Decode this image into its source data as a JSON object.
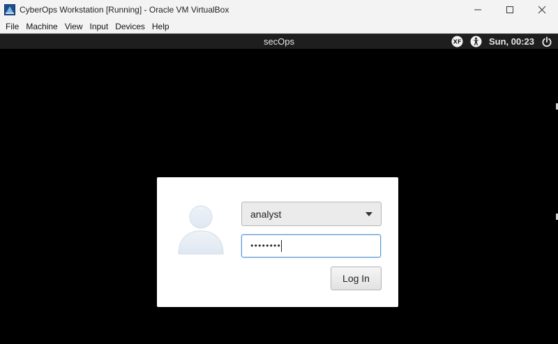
{
  "window": {
    "title": "CyberOps Workstation [Running] - Oracle VM VirtualBox",
    "icon": "virtualbox-icon",
    "controls": [
      "minimize-icon",
      "maximize-icon",
      "close-icon"
    ]
  },
  "menubar": {
    "items": [
      "File",
      "Machine",
      "View",
      "Input",
      "Devices",
      "Help"
    ]
  },
  "panel": {
    "hostname": "secOps",
    "clock": "Sun, 00:23",
    "icons": [
      "xfce-icon",
      "accessibility-icon",
      "power-icon"
    ]
  },
  "login": {
    "avatar_icon": "user-avatar-icon",
    "username": "analyst",
    "password_mask": "••••••••",
    "login_label": "Log In"
  },
  "colors": {
    "focus_border": "#5b9ad6",
    "panel_bg": "#1e1e1e",
    "screen_bg": "#000000"
  }
}
